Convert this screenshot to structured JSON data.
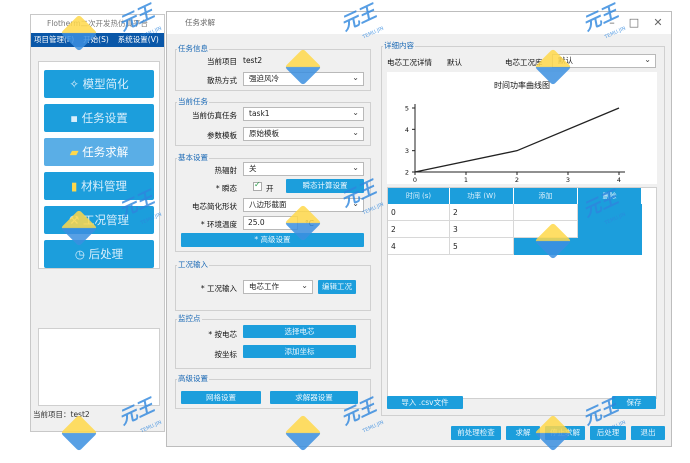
{
  "left_window": {
    "title": "Flotherm二次开发热仿真平台",
    "menu": [
      "项目管理(F)",
      "开始(S)",
      "系统设置(V)"
    ],
    "nav": [
      {
        "label": "模型简化",
        "icon": "magic-icon",
        "active": false
      },
      {
        "label": "任务设置",
        "icon": "square-icon",
        "active": false
      },
      {
        "label": "任务求解",
        "icon": "folder-icon",
        "active": true
      },
      {
        "label": "材料管理",
        "icon": "chart-icon",
        "active": false
      },
      {
        "label": "工况管理",
        "icon": "wrench-icon",
        "active": false
      },
      {
        "label": "后处理",
        "icon": "clock-icon",
        "active": false
      }
    ],
    "status": "当前项目：test2"
  },
  "dialog": {
    "title": "任务求解",
    "task_info": {
      "group": "任务信息",
      "project_label": "当前项目",
      "project_value": "test2",
      "cooling_label": "散热方式",
      "cooling_value": "强迫风冷"
    },
    "current_task": {
      "group": "当前任务",
      "task_label": "当前仿真任务",
      "task_value": "task1",
      "template_label": "参数模板",
      "template_value": "原始模板"
    },
    "basic": {
      "group": "基本设置",
      "radiation_label": "热辐射",
      "radiation_value": "关",
      "transient_label": "* 瞬态",
      "transient_check": "开",
      "transient_btn": "瞬态计算设置",
      "shape_label": "电芯简化形状",
      "shape_value": "八边形截面",
      "ambient_label": "* 环境温度",
      "ambient_value": "25.0",
      "ambient_unit": "°C",
      "advanced_btn": "* 高级设置"
    },
    "workload": {
      "group": "工况输入",
      "label": "* 工况输入",
      "value": "电芯工作",
      "edit_btn": "编辑工况"
    },
    "monitor": {
      "group": "监控点",
      "cell_label": "* 按电芯",
      "cell_btn": "选择电芯",
      "coord_label": "按坐标",
      "coord_btn": "添加坐标"
    },
    "advanced": {
      "group": "高级设置",
      "grid_btn": "网格设置",
      "solver_btn": "求解器设置"
    },
    "detail": {
      "group": "详细内容",
      "detail_label": "电芯工况详情",
      "detail_value": "默认",
      "cell_label": "电芯工况库",
      "cell_value": "默认"
    },
    "table": {
      "headers": [
        "时间 (s)",
        "功率 (W)",
        "添加",
        "删除"
      ],
      "rows": [
        {
          "time": "0",
          "power": "2"
        },
        {
          "time": "2",
          "power": "3"
        },
        {
          "time": "4",
          "power": "5"
        }
      ]
    },
    "import_btn": "导入 .csv文件",
    "save_btn": "保存",
    "bottom_buttons": [
      "前处理检查",
      "求解",
      "停止求解",
      "后处理",
      "退出"
    ]
  },
  "chart_data": {
    "type": "line",
    "title": "时间功率曲线图",
    "x": [
      0,
      2,
      4
    ],
    "values": [
      2,
      3,
      5
    ],
    "x_ticks": [
      "0",
      "1",
      "2",
      "3",
      "4"
    ],
    "y_ticks": [
      "2",
      "3",
      "4",
      "5"
    ],
    "xlim": [
      0,
      4
    ],
    "ylim": [
      2,
      5
    ],
    "grid": false
  },
  "watermarks": {
    "text": "元王",
    "sub": "TEMU.JIN"
  },
  "colors": {
    "accent": "#1c9edc",
    "menubar": "#0a57a8",
    "group_title": "#1a69b5"
  }
}
